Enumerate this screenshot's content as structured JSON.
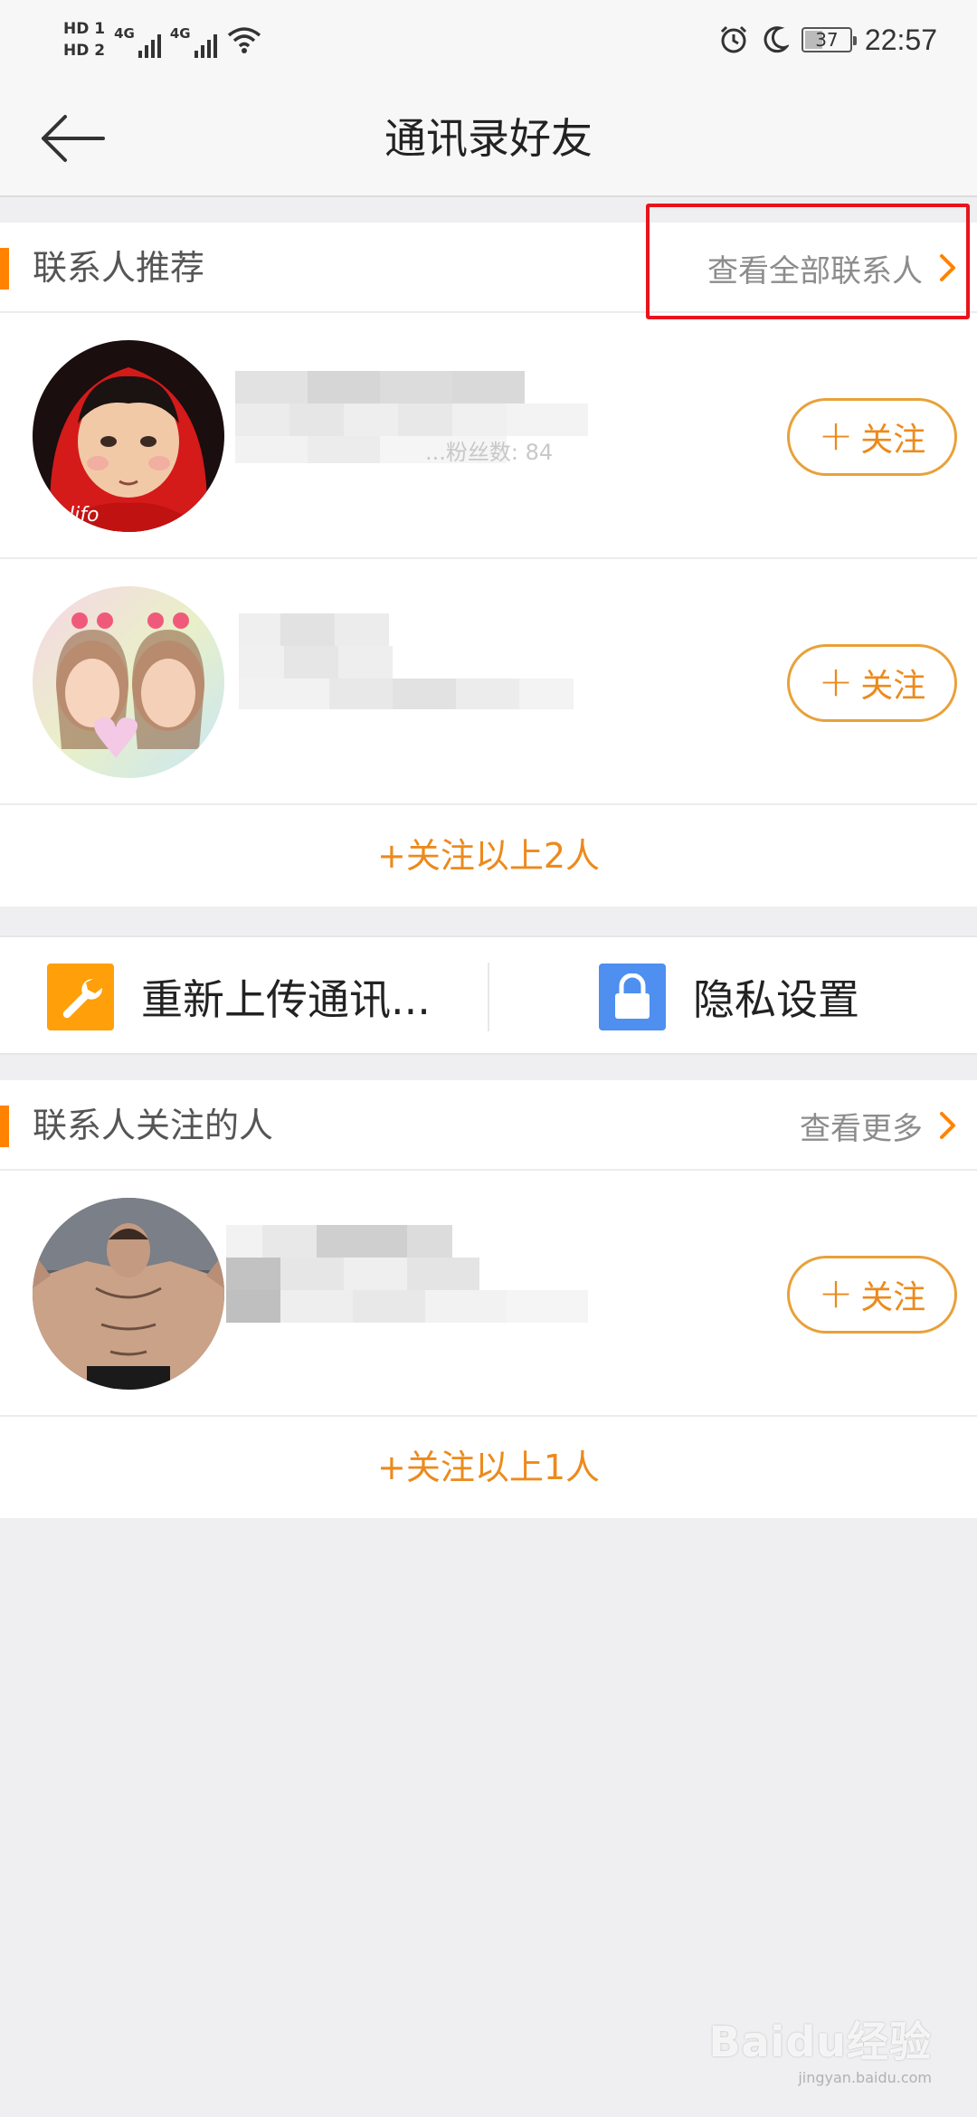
{
  "status_bar": {
    "hd1": "HD 1",
    "hd2": "HD 2",
    "net1": "4G",
    "net2": "4G",
    "battery": "37",
    "time": "22:57"
  },
  "navbar": {
    "title": "通讯录好友"
  },
  "contacts_section": {
    "title": "联系人推荐",
    "more_label": "查看全部联系人",
    "rows": [
      {
        "follow_label": "关注",
        "partial_text": "...粉丝数: 84"
      },
      {
        "follow_label": "关注"
      }
    ],
    "follow_all_label": "+关注以上2人"
  },
  "actions": {
    "reupload_label": "重新上传通讯...",
    "privacy_label": "隐私设置",
    "reupload_color": "#ff9f0a",
    "privacy_color": "#4e8ff0"
  },
  "following_section": {
    "title": "联系人关注的人",
    "more_label": "查看更多",
    "rows": [
      {
        "follow_label": "关注"
      }
    ],
    "follow_all_label": "+关注以上1人"
  },
  "colors": {
    "accent": "#ff8200",
    "follow_text": "#ec8a1c",
    "highlight": "#e8141c"
  },
  "watermark": {
    "logo": "Baidu经验",
    "url": "jingyan.baidu.com"
  }
}
